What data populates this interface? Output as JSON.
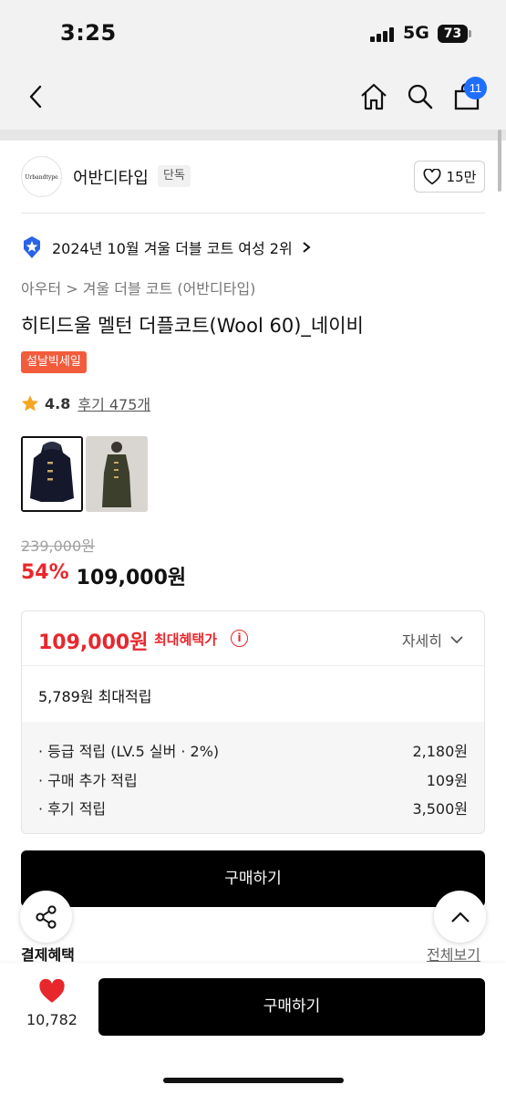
{
  "status": {
    "time": "3:25",
    "network": "5G",
    "battery": "73"
  },
  "nav": {
    "cart_count": "11"
  },
  "brand": {
    "logo_text": "Urbandtype",
    "name": "어반디타입",
    "tag": "단독",
    "likes": "15만"
  },
  "ranking": {
    "text": "2024년 10월 겨울 더블 코트 여성 2위"
  },
  "breadcrumb": {
    "category": "아우터",
    "sub": "겨울 더블 코트 (어반디타입)"
  },
  "product": {
    "title": "히티드울 멜턴 더플코트(Wool 60)_네이비",
    "sale_tag": "설날빅세일",
    "rating": "4.8",
    "reviews": "후기 475개",
    "original_price": "239,000원",
    "discount": "54%",
    "price": "109,000원"
  },
  "benefit": {
    "max_price": "109,000원",
    "max_label": "최대혜택가",
    "detail_label": "자세히",
    "points": "5,789원 최대적립",
    "rows": [
      {
        "label": "· 등급 적립 (LV.5 실버 · 2%)",
        "value": "2,180원"
      },
      {
        "label": "· 구매 추가 적립",
        "value": "109원"
      },
      {
        "label": "· 후기 적립",
        "value": "3,500원"
      }
    ]
  },
  "buy_label": "구매하기",
  "payment": {
    "label": "결제혜택",
    "view_all": "전체보기"
  },
  "bottom": {
    "like_count": "10,782",
    "buy_label": "구매하기"
  }
}
